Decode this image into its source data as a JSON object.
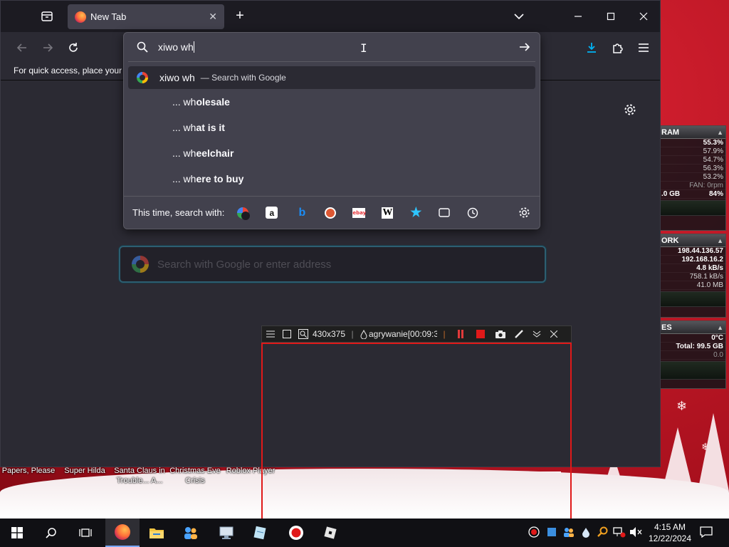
{
  "browser": {
    "tab_title": "New Tab",
    "bookmarks_hint": "For quick access, place your b",
    "page_search_placeholder": "Search with Google or enter address"
  },
  "urlbar": {
    "typed": "xiwo wh",
    "first_suggestion_query": "xiwo wh",
    "first_suggestion_hint": "— Search with Google",
    "suggestions": [
      {
        "prefix": "... wh",
        "rest": "olesale"
      },
      {
        "prefix": "... wh",
        "rest": "at is it"
      },
      {
        "prefix": "... wh",
        "rest": "eelchair"
      },
      {
        "prefix": "... wh",
        "rest": "ere to buy"
      }
    ],
    "oneoff_label": "This time, search with:"
  },
  "recorder": {
    "size": "430x375",
    "title": "agrywanie[00:09:3"
  },
  "desktop_labels": [
    "Papers, Please",
    "Super Hilda",
    "Santa Claus in Trouble... A...",
    "Christmas Eve Crisis",
    "Roblox Player"
  ],
  "gadgets": {
    "ram": {
      "title": "RAM",
      "rows": [
        "55.3%",
        "57.9%",
        "54.7%",
        "56.3%",
        "53.2%"
      ],
      "fan": "FAN: 0rpm",
      "mem_used": ".0 GB",
      "mem_pct": "84%"
    },
    "network": {
      "title": "ORK",
      "external_ip": "198.44.136.57",
      "internal_ip": "192.168.16.2",
      "down": "4.8 kB/s",
      "up": "758.1 kB/s",
      "total": "41.0 MB"
    },
    "drives": {
      "title": "ES",
      "temp": "0°C",
      "total": "Total: 99.5 GB",
      "activity": "0.0"
    }
  },
  "taskbar": {
    "time": "4:15 AM",
    "date": "12/22/2024"
  },
  "colors": {
    "accent_focus": "#2f8aa4",
    "record_red": "#e01919",
    "download_blue": "#00b3f4"
  }
}
